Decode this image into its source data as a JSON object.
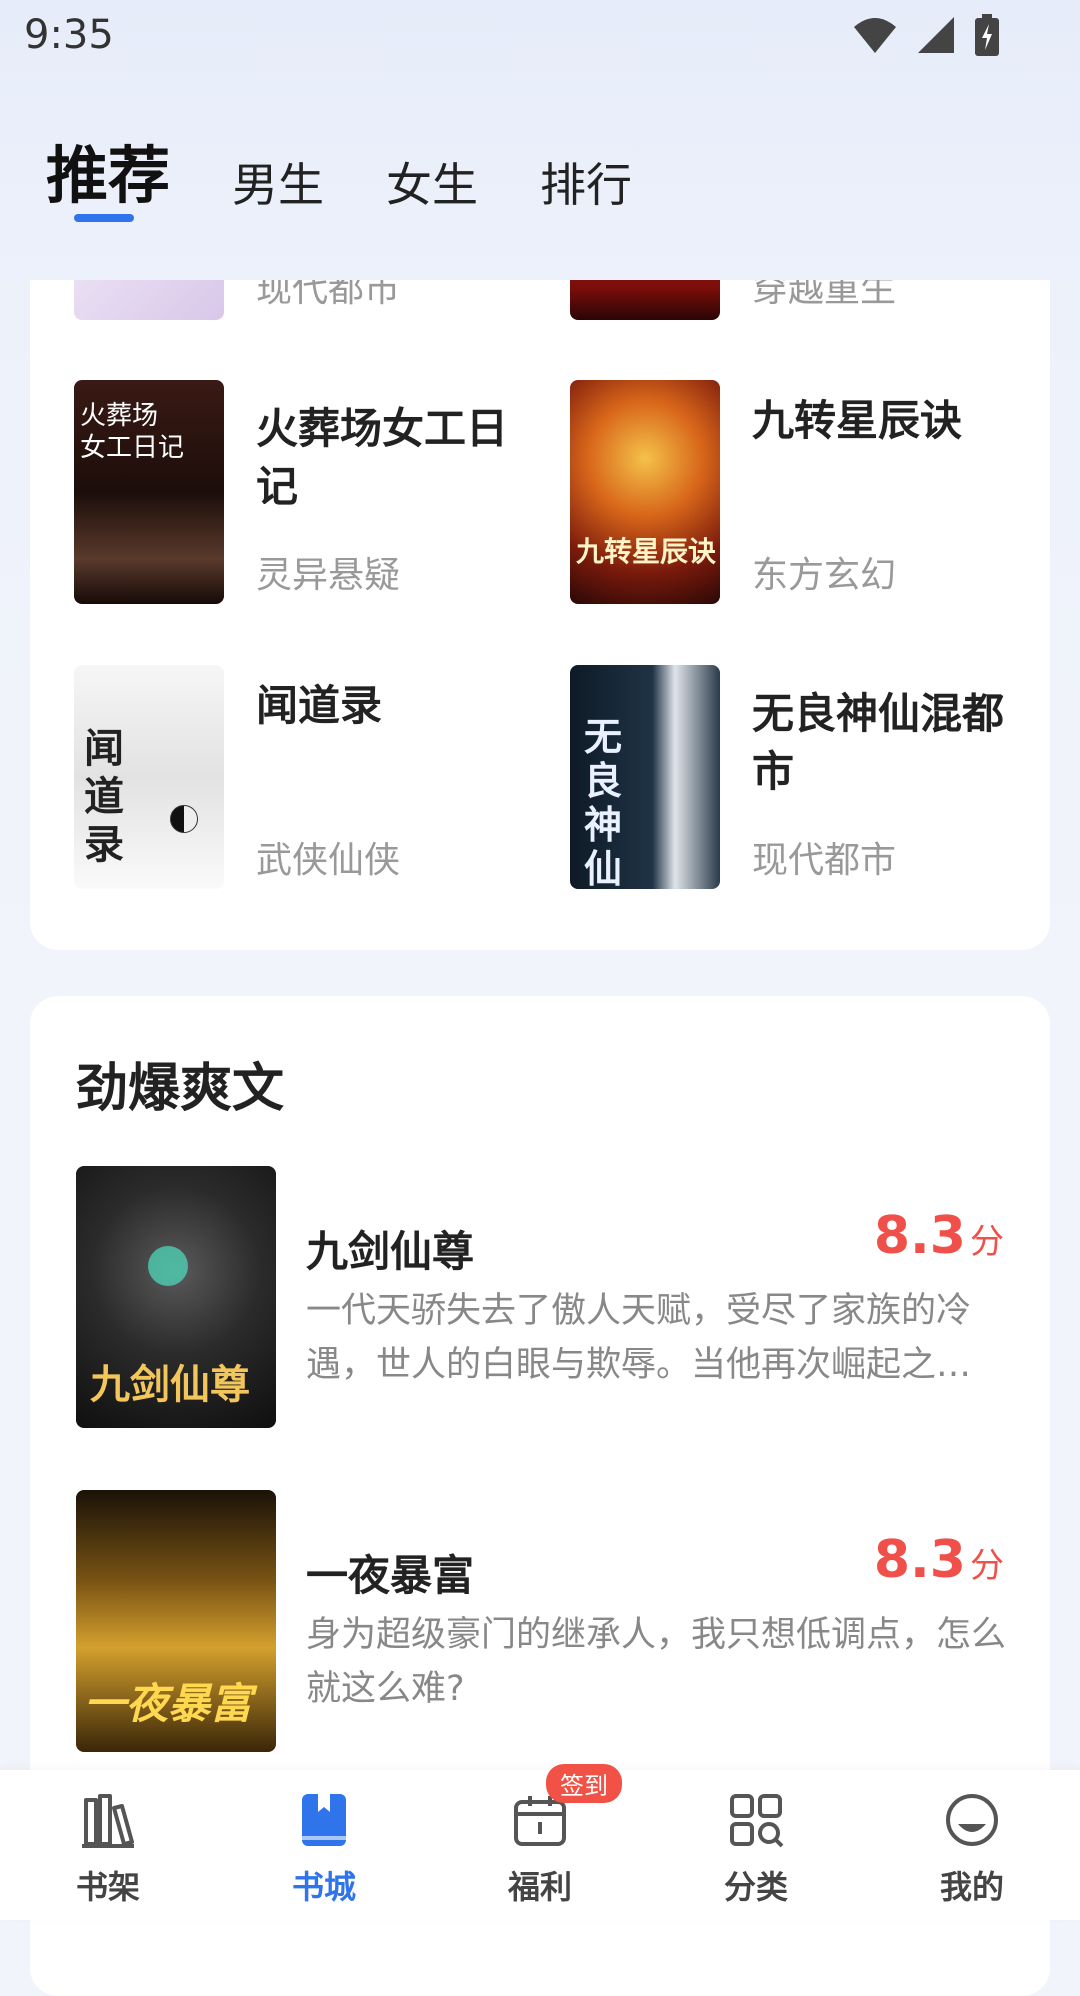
{
  "status_bar": {
    "time": "9:35"
  },
  "tabs": [
    {
      "label": "推荐",
      "active": true
    },
    {
      "label": "男生",
      "active": false
    },
    {
      "label": "女生",
      "active": false
    },
    {
      "label": "排行",
      "active": false
    }
  ],
  "grid_books": [
    {
      "title": "",
      "genre": "现代都市",
      "partial": true
    },
    {
      "title": "",
      "genre": "穿越重生",
      "partial": true
    },
    {
      "title": "火葬场女工日记",
      "genre": "灵异悬疑"
    },
    {
      "title": "九转星辰诀",
      "genre": "东方玄幻"
    },
    {
      "title": "闻道录",
      "genre": "武侠仙侠"
    },
    {
      "title": "无良神仙混都市",
      "genre": "现代都市"
    }
  ],
  "section": {
    "title": "劲爆爽文",
    "books": [
      {
        "title": "九剑仙尊",
        "score": "8.3",
        "score_unit": "分",
        "desc": "一代天骄失去了傲人天赋，受尽了家族的冷遇，世人的白眼与欺辱。当他再次崛起之…"
      },
      {
        "title": "一夜暴富",
        "score": "8.3",
        "score_unit": "分",
        "desc": "身为超级豪门的继承人，我只想低调点，怎么就这么难?"
      }
    ]
  },
  "bottom_nav": [
    {
      "label": "书架",
      "icon": "bookshelf-icon"
    },
    {
      "label": "书城",
      "icon": "bookstore-icon",
      "active": true
    },
    {
      "label": "福利",
      "icon": "gift-calendar-icon",
      "badge": "签到"
    },
    {
      "label": "分类",
      "icon": "category-grid-icon"
    },
    {
      "label": "我的",
      "icon": "profile-icon"
    }
  ],
  "colors": {
    "accent": "#2f74ea",
    "score": "#f0504a",
    "badge": "#f25245"
  }
}
